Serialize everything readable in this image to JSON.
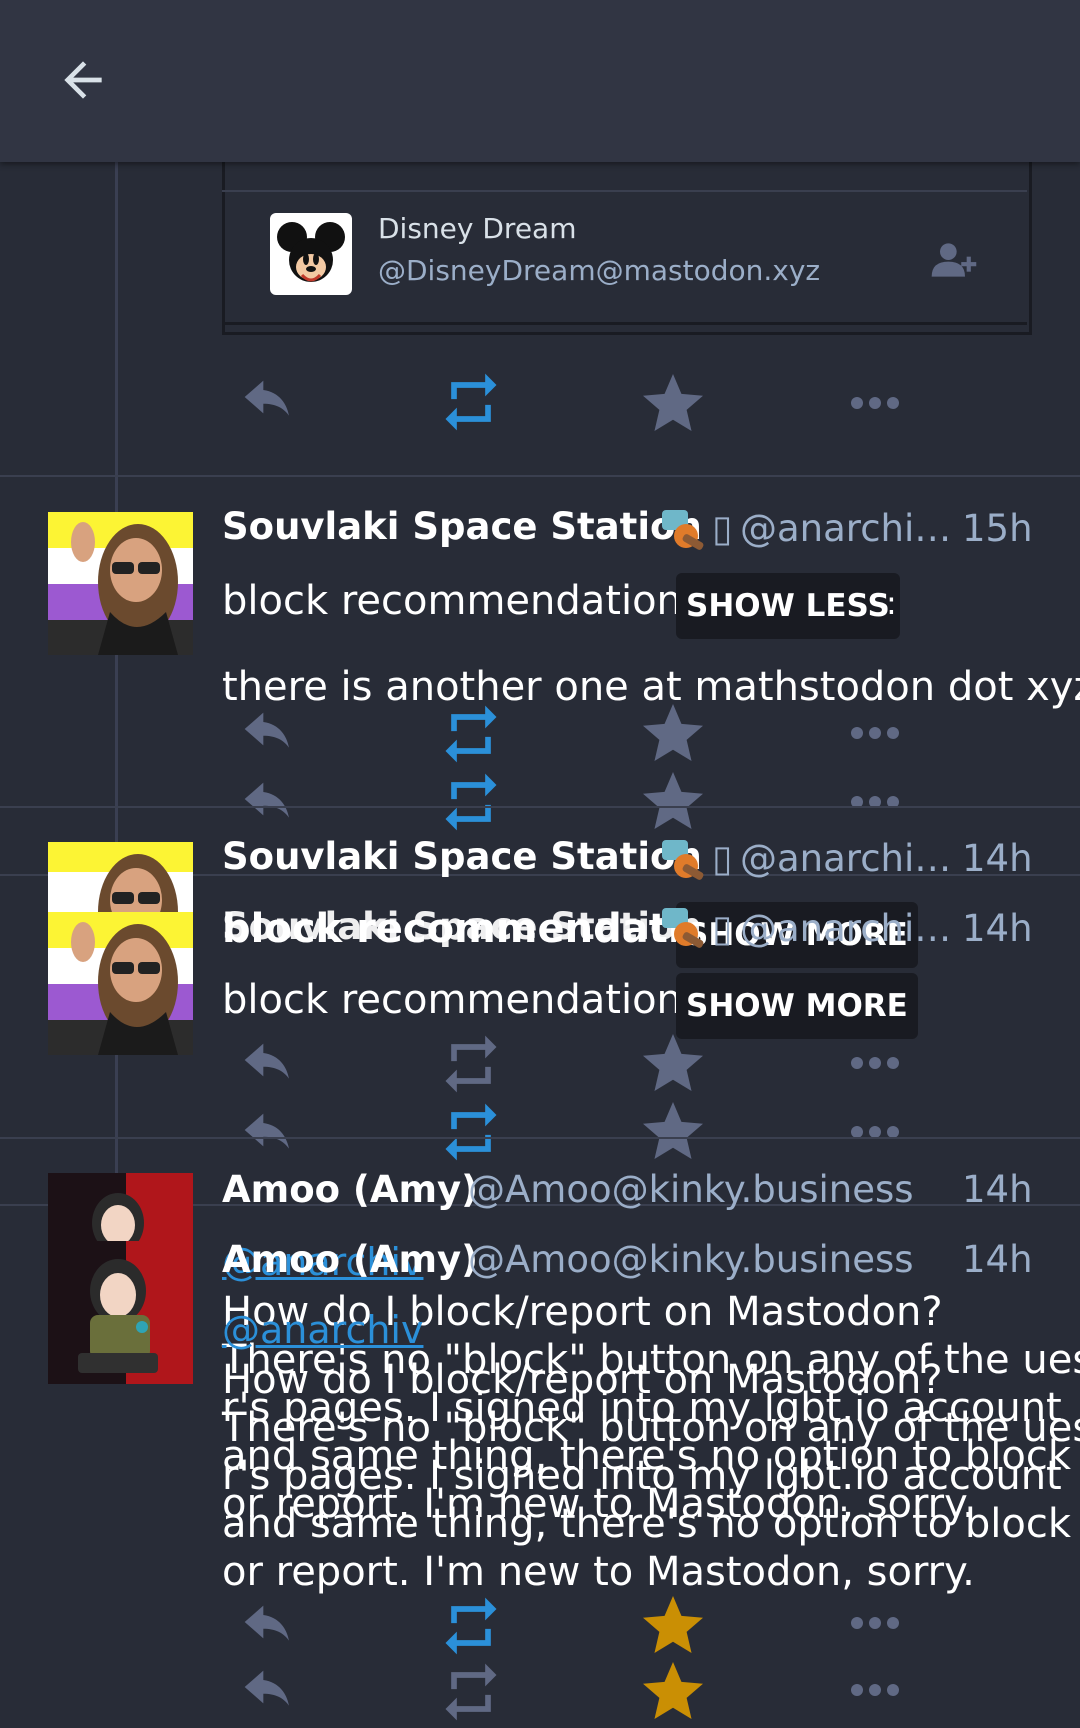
{
  "toolbar": {
    "back_label": "Back"
  },
  "boost_card": {
    "account_name": "Disney Dream",
    "account_handle": "@DisneyDream@mastodon.xyz"
  },
  "statuses": [
    {
      "name": "Souvlaki Space Station",
      "handle": "@anarchi…",
      "time": "15h",
      "spoiler": "block recommendation",
      "toggle_label": "SHOW LESS",
      "content": "there is another one at mathstodon dot xyz"
    },
    {
      "name": "Souvlaki Space Station",
      "handle": "@anarchi…",
      "time": "14h",
      "spoiler": "block recommendation",
      "toggle_label": "SHOW MORE"
    },
    {
      "name": "Souvlaki Space Station",
      "handle": "@anarchi…",
      "time": "14h",
      "spoiler": "block recommendation",
      "toggle_label": "SHOW MORE"
    },
    {
      "name": "Amoo (Amy)",
      "handle": "@Amoo@kinky.business",
      "time": "14h",
      "mention": "@anarchiv",
      "content_lines": [
        "How do I block/report on Mastodon?",
        "There's no \"block\" button on any of the ues-",
        "r's pages. I signed into my lgbt.io account",
        "and same thing, there's no option to block",
        "or report. I'm new to Mastodon, sorry."
      ]
    },
    {
      "name": "Amoo (Amy)",
      "handle": "@Amoo@kinky.business",
      "time": "14h",
      "mention": "@anarchiv",
      "content_lines": [
        "How do I block/report on Mastodon?",
        "There's no \"block\" button on any of the ues-",
        "r's pages. I signed into my lgbt.io account",
        "and same thing, there's no option to block",
        "or report. I'm new to Mastodon, sorry."
      ]
    }
  ],
  "colors": {
    "background": "#282c37",
    "appbar": "#313543",
    "action_inactive": "#606984",
    "boost_active": "#2b90d9",
    "favourite_active": "#ca8f04",
    "secondary_text": "#9baec8"
  }
}
